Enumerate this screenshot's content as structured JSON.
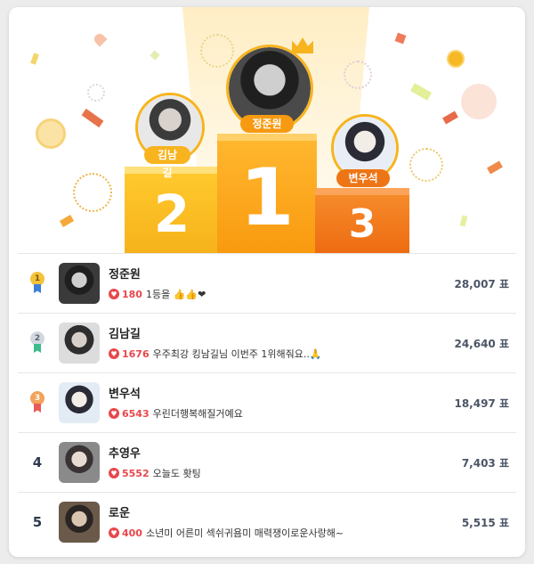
{
  "podium": [
    {
      "place": "1",
      "name": "정준원"
    },
    {
      "place": "2",
      "name": "김남길"
    },
    {
      "place": "3",
      "name": "변우석"
    }
  ],
  "rankings": [
    {
      "rank": "1",
      "name": "정준원",
      "count": "180",
      "message": "1등을 👍👍❤",
      "votes": "28,007 표",
      "medal_color": "#f4c13a",
      "ribbon_color": "#3d7fd8"
    },
    {
      "rank": "2",
      "name": "김남길",
      "count": "1676",
      "message": "우주최강 킹남길님 이번주 1위해줘요..🙏",
      "votes": "24,640 표",
      "medal_color": "#c8cdd6",
      "ribbon_color": "#3dbb8c"
    },
    {
      "rank": "3",
      "name": "변우석",
      "count": "6543",
      "message": "우린더행복해질거예요",
      "votes": "18,497 표",
      "medal_color": "#f2a35a",
      "ribbon_color": "#e85a5a"
    },
    {
      "rank": "4",
      "name": "추영우",
      "count": "5552",
      "message": "오늘도 홧팅",
      "votes": "7,403 표"
    },
    {
      "rank": "5",
      "name": "로운",
      "count": "400",
      "message": "소년미 어른미 섹쉬귀욤미 매력쟁이로운사랑해~",
      "votes": "5,515 표"
    }
  ],
  "colors": {
    "accent": "#f79a12",
    "heart": "#e8474c"
  }
}
